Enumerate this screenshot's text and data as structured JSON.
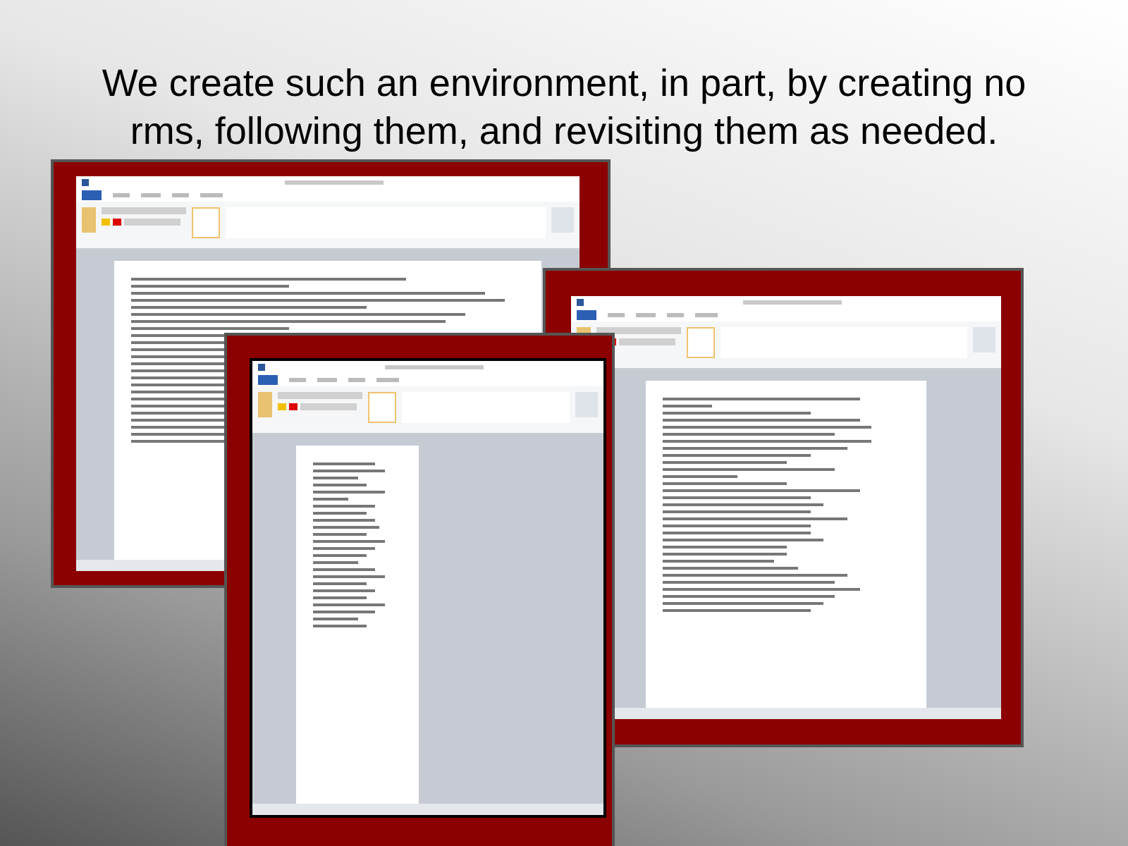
{
  "slide": {
    "title_lines": [
      "We create such an environment, in part, by creating no",
      "rms, following them, and revisiting them as needed."
    ]
  }
}
